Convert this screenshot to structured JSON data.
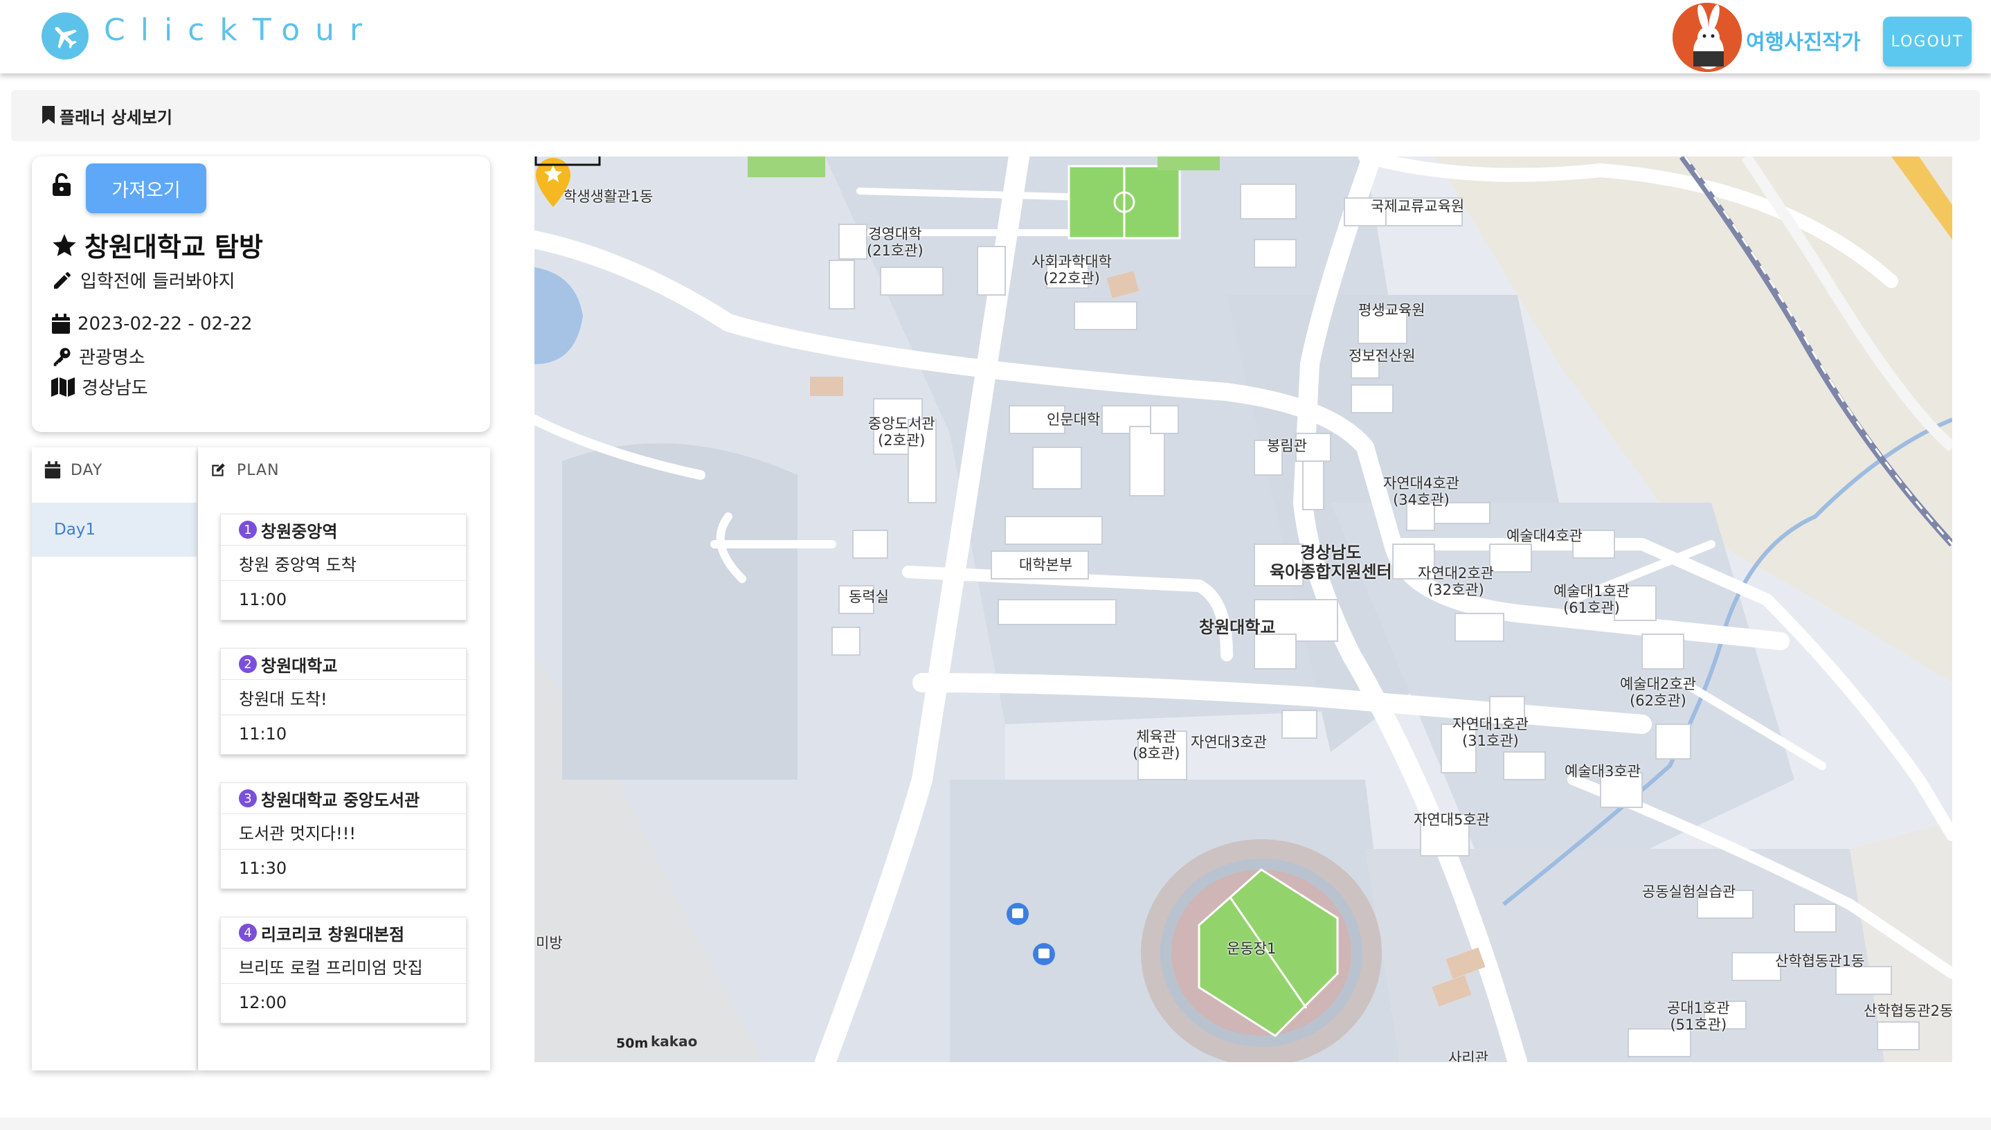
{
  "header": {
    "brand": "ClickTour",
    "username": "여행사진작가",
    "logout_label": "LOGOUT"
  },
  "breadcrumb": {
    "title": "플래너 상세보기"
  },
  "planner": {
    "import_label": "가져오기",
    "title": "창원대학교 탐방",
    "description": "입학전에 들러봐야지",
    "dates": "2023-02-22 - 02-22",
    "category": "관광명소",
    "region": "경상남도"
  },
  "columns": {
    "day_header": "DAY",
    "plan_header": "PLAN"
  },
  "days": [
    "Day1"
  ],
  "stops": [
    {
      "num": "1",
      "place": "창원중앙역",
      "memo": "창원 중앙역 도착",
      "time": "11:00"
    },
    {
      "num": "2",
      "place": "창원대학교",
      "memo": "창원대 도착!",
      "time": "11:10"
    },
    {
      "num": "3",
      "place": "창원대학교 중앙도서관",
      "memo": "도서관 멋지다!!!",
      "time": "11:30"
    },
    {
      "num": "4",
      "place": "리코리코 창원대본점",
      "memo": "브리또 로컬 프리미엄 맛집",
      "time": "12:00"
    }
  ],
  "map": {
    "labels": [
      "학생생활관1동",
      "경영대학\n(21호관)",
      "사회과학대학\n(22호관)",
      "국제교류교육원",
      "평생교육원",
      "정보전산원",
      "중앙도서관\n(2호관)",
      "인문대학",
      "봉림관",
      "자연대4호관\n(34호관)",
      "예술대4호관",
      "경상남도\n육아종합지원센터",
      "자연대2호관\n(32호관)",
      "예술대1호관\n(61호관)",
      "대학본부",
      "동력실",
      "창원대학교",
      "예술대2호관\n(62호관)",
      "체육관\n(8호관)",
      "자연대3호관",
      "자연대1호관\n(31호관)",
      "예술대3호관",
      "자연대5호관",
      "공동실험실습관",
      "운동장1",
      "산학협동관1동",
      "미방",
      "공대1호관\n(51호관)",
      "산학협동관2동",
      "사리관"
    ],
    "scale": "50m",
    "attribution": "kakao",
    "marker_place": "창원대학교"
  }
}
